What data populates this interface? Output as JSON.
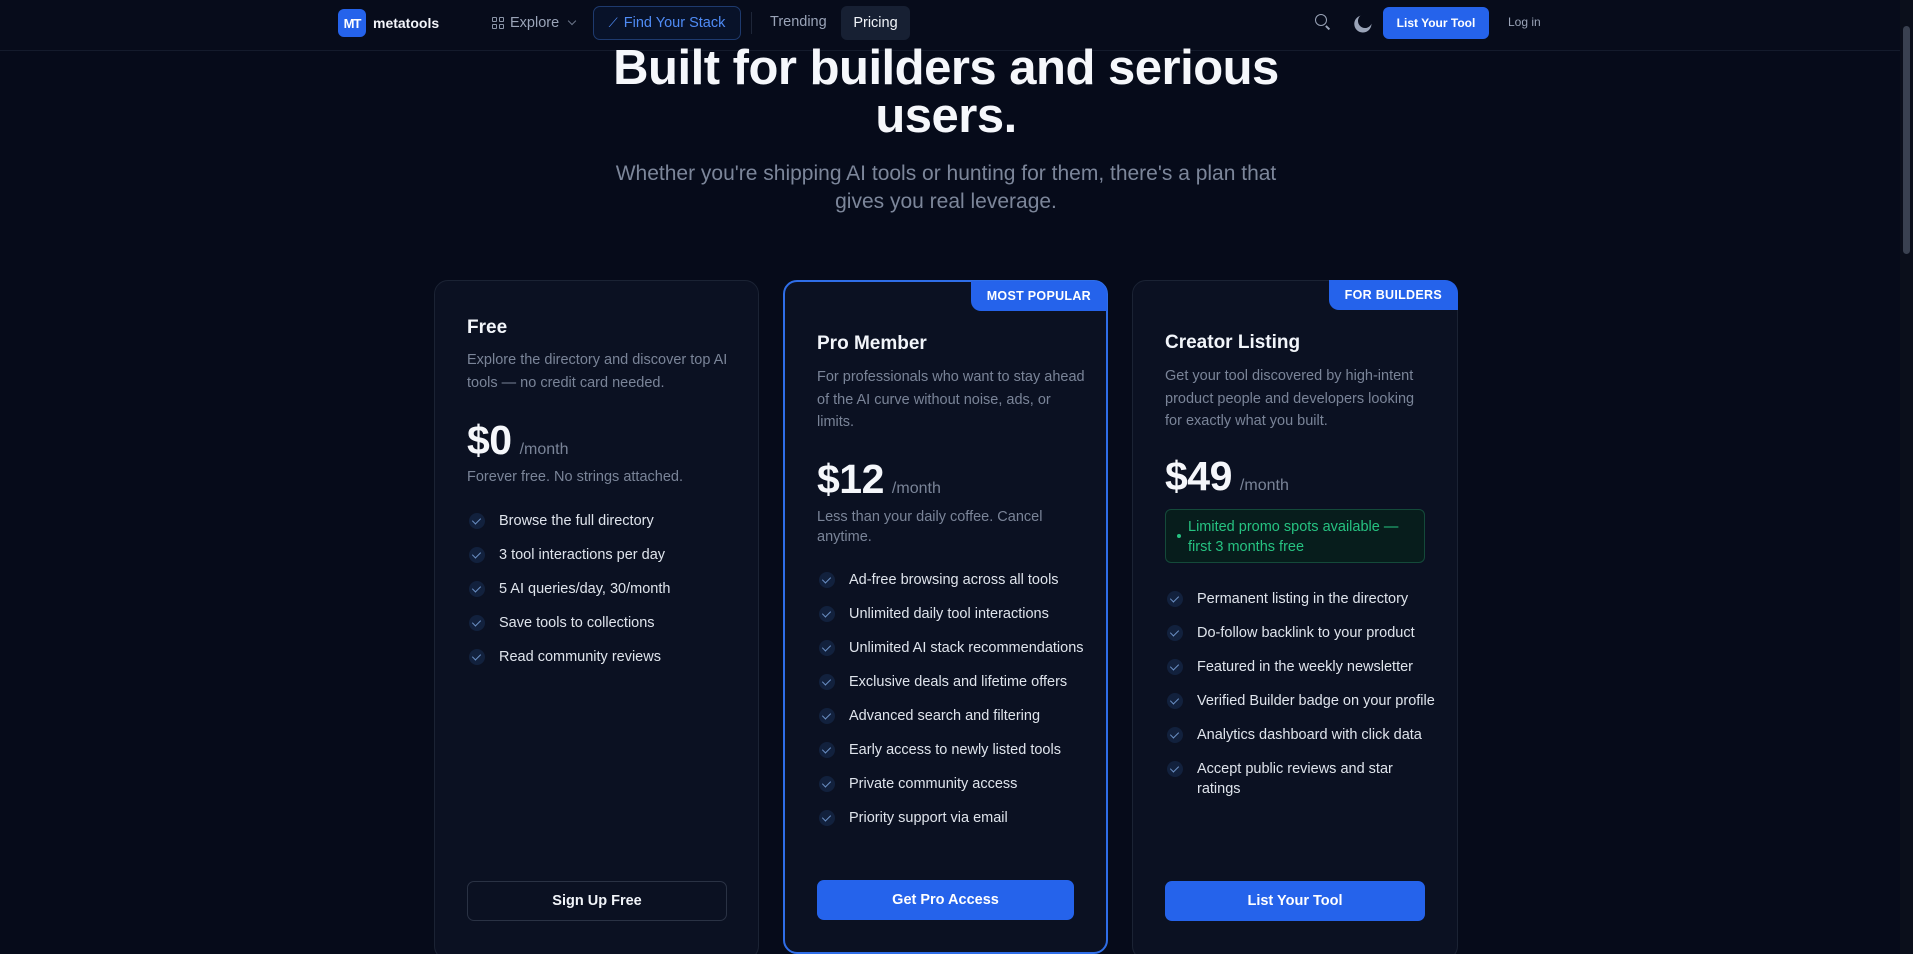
{
  "nav": {
    "logo_mark": "MT",
    "logo_text": "metatools",
    "explore": "Explore",
    "find_stack": "Find Your Stack",
    "trending": "Trending",
    "pricing": "Pricing",
    "cta": "List Your Tool",
    "login": "Log in"
  },
  "hero": {
    "title": "Built for builders and serious users.",
    "subtitle": "Whether you're shipping AI tools or hunting for them, there's a plan that gives you real leverage."
  },
  "plans": [
    {
      "name": "Free",
      "description": "Explore the directory and discover top AI tools — no credit card needed.",
      "price": "$0",
      "period": "/month",
      "note": "Forever free. No strings attached.",
      "features": [
        "Browse the full directory",
        "3 tool interactions per day",
        "5 AI queries/day, 30/month",
        "Save tools to collections",
        "Read community reviews"
      ],
      "button": "Sign Up Free"
    },
    {
      "badge": "MOST POPULAR",
      "name": "Pro Member",
      "description": "For professionals who want to stay ahead of the AI curve without noise, ads, or limits.",
      "price": "$12",
      "period": "/month",
      "note": "Less than your daily coffee. Cancel anytime.",
      "features": [
        "Ad-free browsing across all tools",
        "Unlimited daily tool interactions",
        "Unlimited AI stack recommendations",
        "Exclusive deals and lifetime offers",
        "Advanced search and filtering",
        "Early access to newly listed tools",
        "Private community access",
        "Priority support via email"
      ],
      "button": "Get Pro Access"
    },
    {
      "badge": "FOR BUILDERS",
      "name": "Creator Listing",
      "description": "Get your tool discovered by high-intent product people and developers looking for exactly what you built.",
      "price": "$49",
      "period": "/month",
      "promo": "Limited promo spots available — first 3 months free",
      "features": [
        "Permanent listing in the directory",
        "Do-follow backlink to your product",
        "Featured in the weekly newsletter",
        "Verified Builder badge on your profile",
        "Analytics dashboard with click data",
        "Accept public reviews and star ratings"
      ],
      "button": "List Your Tool"
    }
  ],
  "colors": {
    "background": "#060b1a",
    "card": "#0b1122",
    "accent": "#2563eb",
    "promo_green": "#26c281"
  }
}
